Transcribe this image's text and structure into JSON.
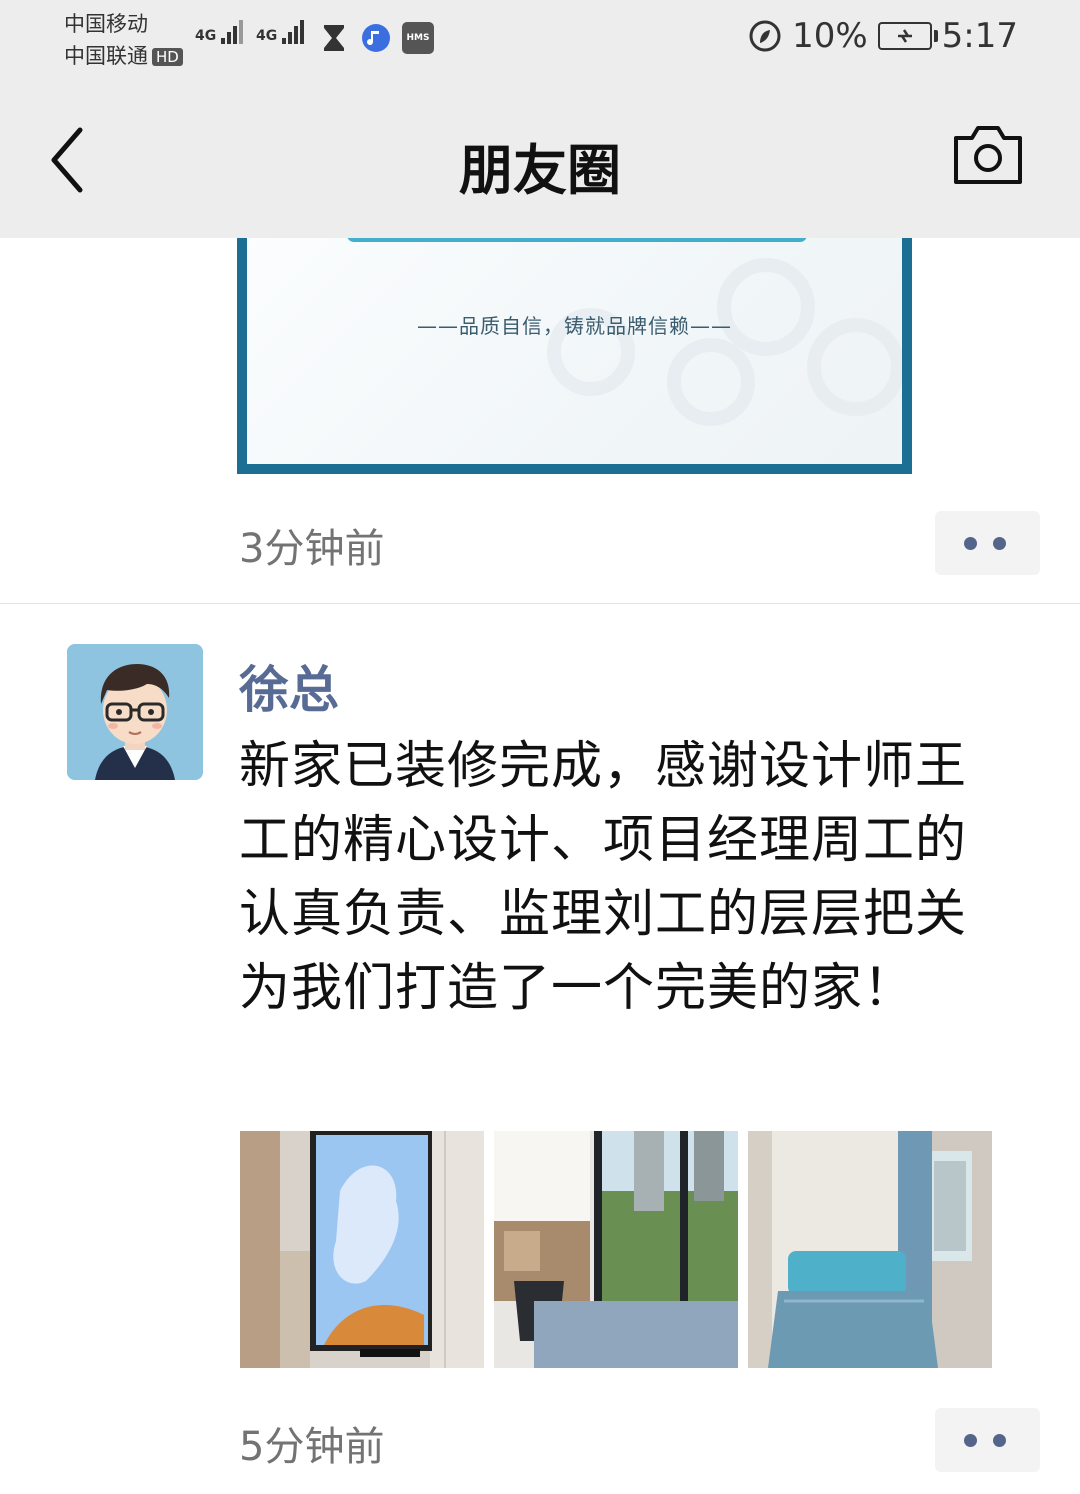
{
  "status_bar": {
    "carrier_1": "中国移动",
    "carrier_2": "中国联通",
    "hd_badge": "HD",
    "net_1": "4G",
    "net_2": "4G",
    "hms_label": "HMS",
    "battery_percent": "10%",
    "time": "5:17"
  },
  "navbar": {
    "title": "朋友圈",
    "back_icon": "chevron-left-icon",
    "camera_icon": "camera-icon"
  },
  "post_1": {
    "poster_slogan": "——品质自信，铸就品牌信赖——",
    "time": "3分钟前",
    "more_icon": "more-dots-icon"
  },
  "post_2": {
    "author": "徐总",
    "text": "新家已装修完成，感谢设计师王工的精心设计、项目经理周工的认真负责、监理刘工的层层把关为我们打造了一个完美的家！",
    "photos": [
      "tv-wall-photo",
      "study-window-photo",
      "bedroom-photo"
    ],
    "time": "5分钟前",
    "more_icon": "more-dots-icon"
  },
  "colors": {
    "nav_bg": "#ededed",
    "username": "#576b95",
    "timestamp": "#737373",
    "more_dots": "#55658a",
    "poster_frame": "#1c6e92"
  }
}
